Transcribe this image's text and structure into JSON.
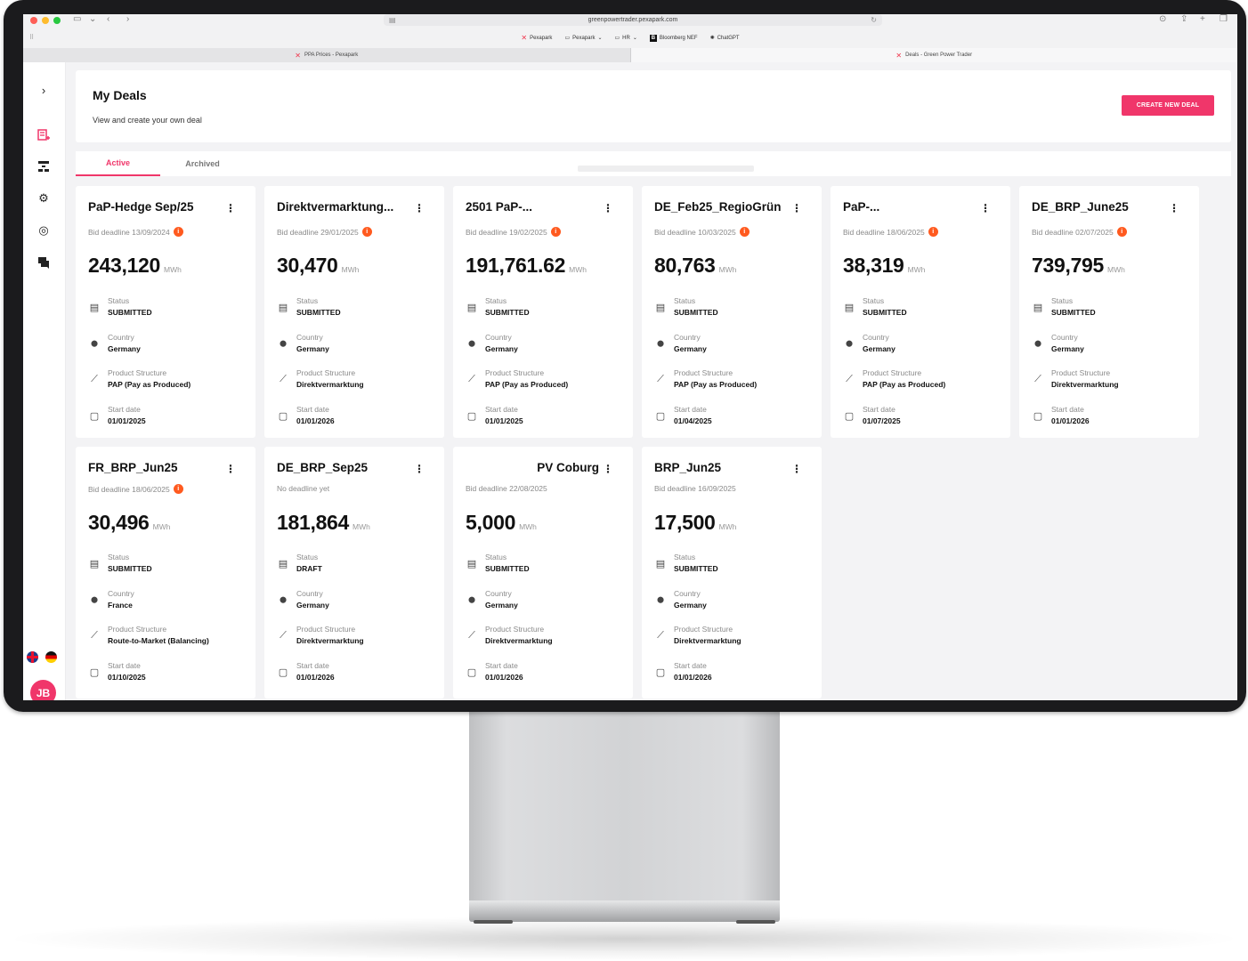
{
  "browser": {
    "url": "greenpowertrader.pexapark.com",
    "bookmarks": [
      "Pexapark",
      "Pexapark",
      "HR",
      "Bloomberg NEF",
      "ChatGPT"
    ],
    "tabs": [
      {
        "label": "PPA Prices - Pexapark"
      },
      {
        "label": "Deals - Green Power Trader"
      }
    ]
  },
  "page": {
    "title": "My Deals",
    "subtitle": "View and create your own deal",
    "create_button": "CREATE NEW DEAL",
    "tabs": [
      "Active",
      "Archived"
    ]
  },
  "sidebar": {
    "avatar_initials": "JB"
  },
  "field_labels": {
    "status": "Status",
    "country": "Country",
    "product_structure": "Product Structure",
    "start_date": "Start date",
    "unit": "MWh"
  },
  "deals": [
    {
      "title": "PaP-Hedge Sep/25",
      "deadline": "Bid deadline 13/09/2024",
      "deadline_info": true,
      "amount": "243,120",
      "status": "SUBMITTED",
      "country": "Germany",
      "product": "PAP (Pay as Produced)",
      "start": "01/01/2025"
    },
    {
      "title": "Direktvermarktung...",
      "deadline": "Bid deadline 29/01/2025",
      "deadline_info": true,
      "amount": "30,470",
      "status": "SUBMITTED",
      "country": "Germany",
      "product": "Direktvermarktung",
      "start": "01/01/2026"
    },
    {
      "title": "2501 PaP-...",
      "deadline": "Bid deadline 19/02/2025",
      "deadline_info": true,
      "amount": "191,761.62",
      "status": "SUBMITTED",
      "country": "Germany",
      "product": "PAP (Pay as Produced)",
      "start": "01/01/2025"
    },
    {
      "title": "DE_Feb25_RegioGrün",
      "deadline": "Bid deadline 10/03/2025",
      "deadline_info": true,
      "amount": "80,763",
      "status": "SUBMITTED",
      "country": "Germany",
      "product": "PAP (Pay as Produced)",
      "start": "01/04/2025"
    },
    {
      "title": "PaP-...",
      "deadline": "Bid deadline 18/06/2025",
      "deadline_info": true,
      "amount": "38,319",
      "status": "SUBMITTED",
      "country": "Germany",
      "product": "PAP (Pay as Produced)",
      "start": "01/07/2025"
    },
    {
      "title": "DE_BRP_June25",
      "deadline": "Bid deadline 02/07/2025",
      "deadline_info": true,
      "amount": "739,795",
      "status": "SUBMITTED",
      "country": "Germany",
      "product": "Direktvermarktung",
      "start": "01/01/2026"
    },
    {
      "title": "FR_BRP_Jun25",
      "deadline": "Bid deadline 18/06/2025",
      "deadline_info": true,
      "amount": "30,496",
      "status": "SUBMITTED",
      "country": "France",
      "product": "Route-to-Market (Balancing)",
      "start": "01/10/2025"
    },
    {
      "title": "DE_BRP_Sep25",
      "deadline": "No deadline yet",
      "deadline_info": false,
      "amount": "181,864",
      "status": "DRAFT",
      "country": "Germany",
      "product": "Direktvermarktung",
      "start": "01/01/2026"
    },
    {
      "title": "PV Coburg",
      "deadline": "Bid deadline 22/08/2025",
      "deadline_info": false,
      "amount": "5,000",
      "status": "SUBMITTED",
      "country": "Germany",
      "product": "Direktvermarktung",
      "start": "01/01/2026"
    },
    {
      "title": "BRP_Jun25",
      "deadline": "Bid deadline 16/09/2025",
      "deadline_info": false,
      "amount": "17,500",
      "status": "SUBMITTED",
      "country": "Germany",
      "product": "Direktvermarktung",
      "start": "01/01/2026"
    }
  ],
  "colors": {
    "accent": "#f0366a",
    "info": "#ff5a1f"
  }
}
